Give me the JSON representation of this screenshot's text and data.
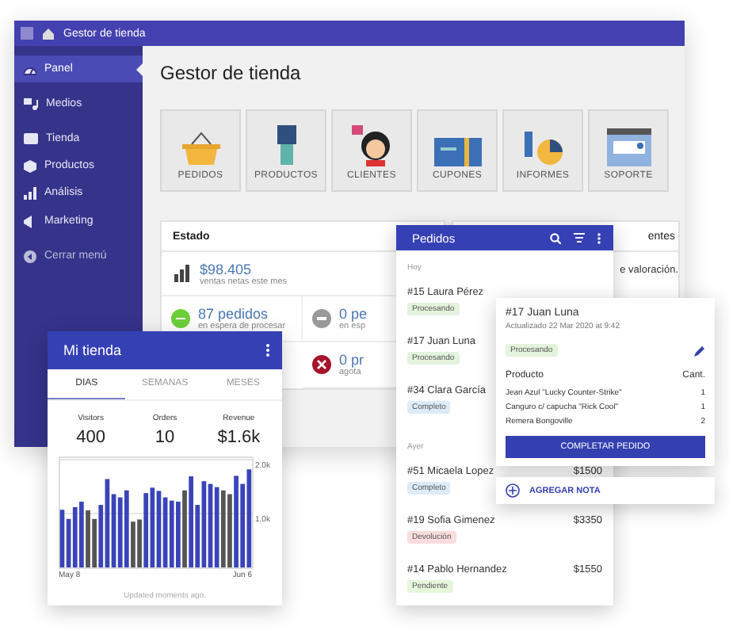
{
  "topbar": {
    "title": "Gestor de tienda"
  },
  "sidebar": {
    "items": [
      {
        "label": "Panel",
        "selected": true
      },
      {
        "label": "Medios",
        "selected": false
      },
      {
        "label": "Tienda",
        "selected": false
      },
      {
        "label": "Productos",
        "selected": false
      },
      {
        "label": "Análisis",
        "selected": false
      },
      {
        "label": "Marketing",
        "selected": false
      }
    ],
    "collapse": "Cerrar menú"
  },
  "main": {
    "title": "Gestor de tienda",
    "tiles": [
      "PEDIDOS",
      "PRODUCTOS",
      "CLIENTES",
      "CUPONES",
      "INFORMES",
      "SOPORTE"
    ],
    "status_card": {
      "title": "Estado",
      "sales": {
        "value": "$98.405",
        "caption": "ventas netas este mes"
      },
      "stats": [
        {
          "kind": "pending",
          "value": "87 pedidos",
          "caption": "en espera de procesar"
        },
        {
          "kind": "hold",
          "value": "0 pe",
          "caption": "en esp"
        },
        {
          "kind": "out",
          "value": "0 pr",
          "caption": "agota"
        }
      ]
    },
    "reviews_card": {
      "title": "entes",
      "text": "e valoración."
    }
  },
  "store_card": {
    "title": "Mi tienda",
    "tabs": [
      {
        "label": "DIAS",
        "selected": true
      },
      {
        "label": "SEMANAS",
        "selected": false
      },
      {
        "label": "MESES",
        "selected": false
      }
    ],
    "stats": [
      {
        "label": "Visitors",
        "value": "400"
      },
      {
        "label": "Orders",
        "value": "10"
      },
      {
        "label": "Revenue",
        "value": "$1.6k"
      }
    ],
    "chart_data": {
      "type": "bar",
      "stacked": true,
      "ylim": [
        0,
        2000
      ],
      "yticks": [
        {
          "value": 1000,
          "label": "1.0k"
        },
        {
          "value": 2000,
          "label": "2.0k"
        }
      ],
      "series": [
        {
          "color": "#3a44b8",
          "values": [
            1070,
            900,
            1120,
            1220,
            null,
            null,
            1160,
            1640,
            1360,
            1300,
            1430,
            null,
            null,
            1380,
            1480,
            1420,
            1300,
            1240,
            1220,
            null,
            1690,
            1160,
            1600,
            1550,
            1490,
            null,
            null,
            1700,
            1550,
            1820
          ]
        },
        {
          "color": "#555555",
          "values": [
            null,
            null,
            null,
            null,
            1060,
            900,
            null,
            null,
            null,
            null,
            null,
            850,
            890,
            null,
            null,
            null,
            null,
            null,
            null,
            1430,
            null,
            null,
            null,
            null,
            null,
            1430,
            1360,
            null,
            null,
            null
          ]
        }
      ]
    },
    "range_start": "May 8",
    "range_end": "Jun 6",
    "footer": "Updated moments ago."
  },
  "orders_card": {
    "title": "Pedidos",
    "groups": [
      {
        "label": "Hoy",
        "orders": [
          {
            "name": "#15 Laura Pérez",
            "status": "Procesando",
            "color": "#e3f3dc"
          },
          {
            "name": "#17 Juan Luna",
            "status": "Procesando",
            "color": "#e3f3dc"
          },
          {
            "name": "#34 Clara García",
            "status": "Completo",
            "color": "#dcebf6"
          }
        ]
      },
      {
        "label": "Ayer",
        "orders": [
          {
            "name": "#51 Micaela Lopez",
            "amount": "$1500",
            "status": "Completo",
            "color": "#dcebf6"
          },
          {
            "name": "#19 Sofia Gimenez",
            "amount": "$3350",
            "status": "Devolución",
            "color": "#fadcdc"
          },
          {
            "name": "#14 Pablo Hernandez",
            "amount": "$1550",
            "status": "Pendiente",
            "color": "#e6f6dc"
          }
        ]
      }
    ]
  },
  "order_detail": {
    "title": "#17 Juan Luna",
    "updated": "Actualizado 22 Mar 2020 at 9:42",
    "status": {
      "label": "Procesando",
      "color": "#e3f3dc"
    },
    "columns": [
      "Producto",
      "Cant."
    ],
    "items": [
      {
        "name": "Jean Azul \"Lucky Counter-Strike\"",
        "qty": "1"
      },
      {
        "name": "Canguro c/ capucha \"Rick Cool\"",
        "qty": "1"
      },
      {
        "name": "Remera Bongoville",
        "qty": "2"
      }
    ],
    "button": "COMPLETAR PEDIDO"
  },
  "add_note": {
    "label": "AGREGAR NOTA"
  }
}
